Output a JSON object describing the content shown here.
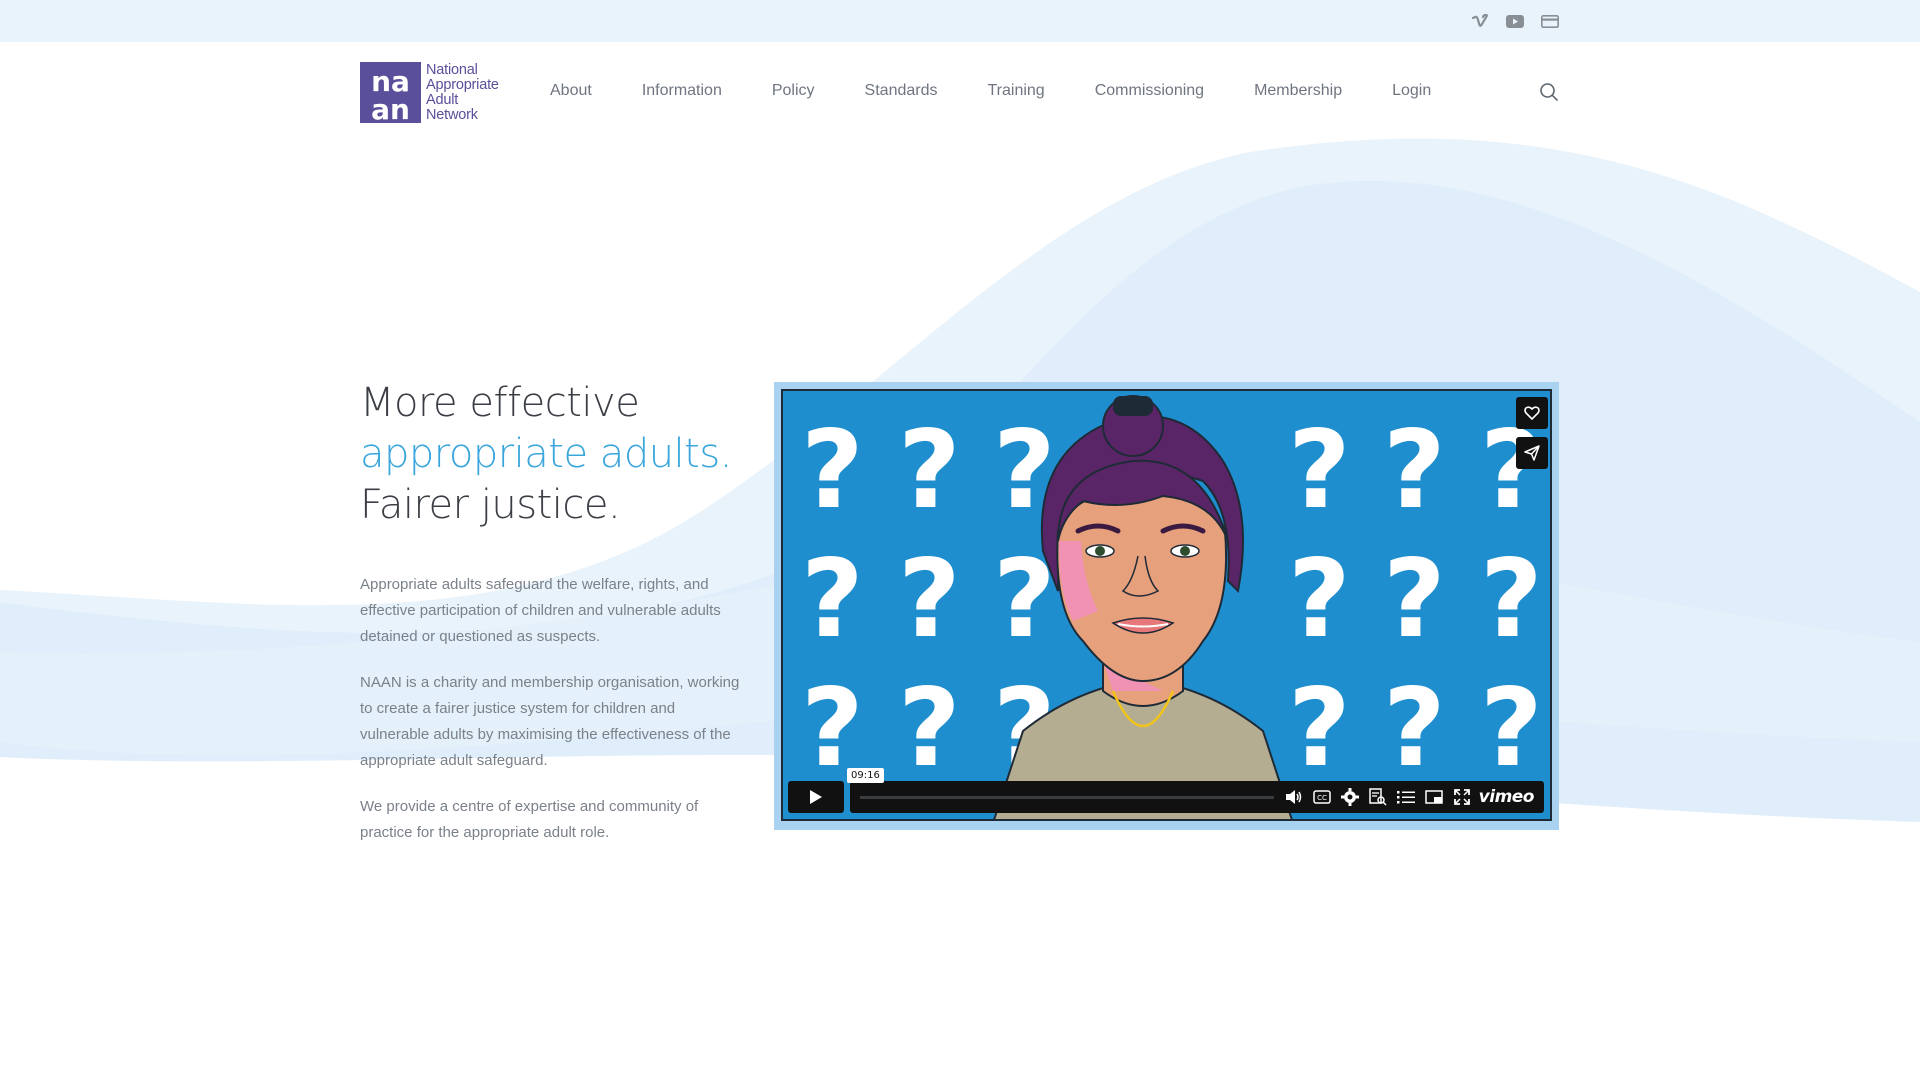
{
  "topbar": {
    "icons": [
      "vimeo-icon",
      "youtube-icon",
      "card-icon"
    ]
  },
  "logo": {
    "mark_letters": [
      "na",
      "an"
    ],
    "lines": [
      "National",
      "Appropriate",
      "Adult",
      "Network"
    ],
    "color": "#5a4f9a"
  },
  "nav": {
    "items": [
      "About",
      "Information",
      "Policy",
      "Standards",
      "Training",
      "Commissioning",
      "Membership",
      "Login"
    ]
  },
  "hero": {
    "line1": "More effective",
    "line2": "appropriate adults.",
    "line3": "Fairer justice.",
    "accent_color": "#3ba6dc"
  },
  "copy": {
    "p1": "Appropriate adults safeguard the welfare, rights, and effective participation of children and vulnerable adults detained or questioned as suspects.",
    "p2": "NAAN is a charity and membership organisation, working to create a fairer justice system for children and vulnerable adults by maximising the effectiveness of the appropriate adult safeguard.",
    "p3": "We provide a centre of expertise and community of practice for the appropriate adult role."
  },
  "video": {
    "duration": "09:16",
    "player_brand": "vimeo",
    "background_color": "#1f8ece",
    "controls": [
      "play-icon",
      "volume-icon",
      "captions-icon",
      "settings-icon",
      "transcript-icon",
      "chapters-icon",
      "pip-icon",
      "fullscreen-icon"
    ],
    "side_buttons": [
      "like-icon",
      "share-icon"
    ]
  }
}
